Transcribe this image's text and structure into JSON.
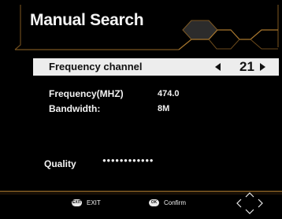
{
  "header": {
    "title": "Manual Search"
  },
  "frequency_channel": {
    "label": "Frequency channel",
    "value": "21"
  },
  "info": {
    "frequency_label": "Frequency(MHZ)",
    "frequency_value": "474.0",
    "bandwidth_label": "Bandwidth:",
    "bandwidth_value": "8M"
  },
  "quality": {
    "label": "Quality",
    "dots": "●●●●●●●●●●●●"
  },
  "footer": {
    "exit_button": "EXIT",
    "exit_label": "EXIT",
    "ok_button": "OK",
    "confirm_label": "Confirm"
  },
  "colors": {
    "frame": "#7a5520",
    "frame_glow": "#c08838",
    "highlight_row": "#ededed",
    "text": "#f2f2f2",
    "background": "#000000"
  }
}
